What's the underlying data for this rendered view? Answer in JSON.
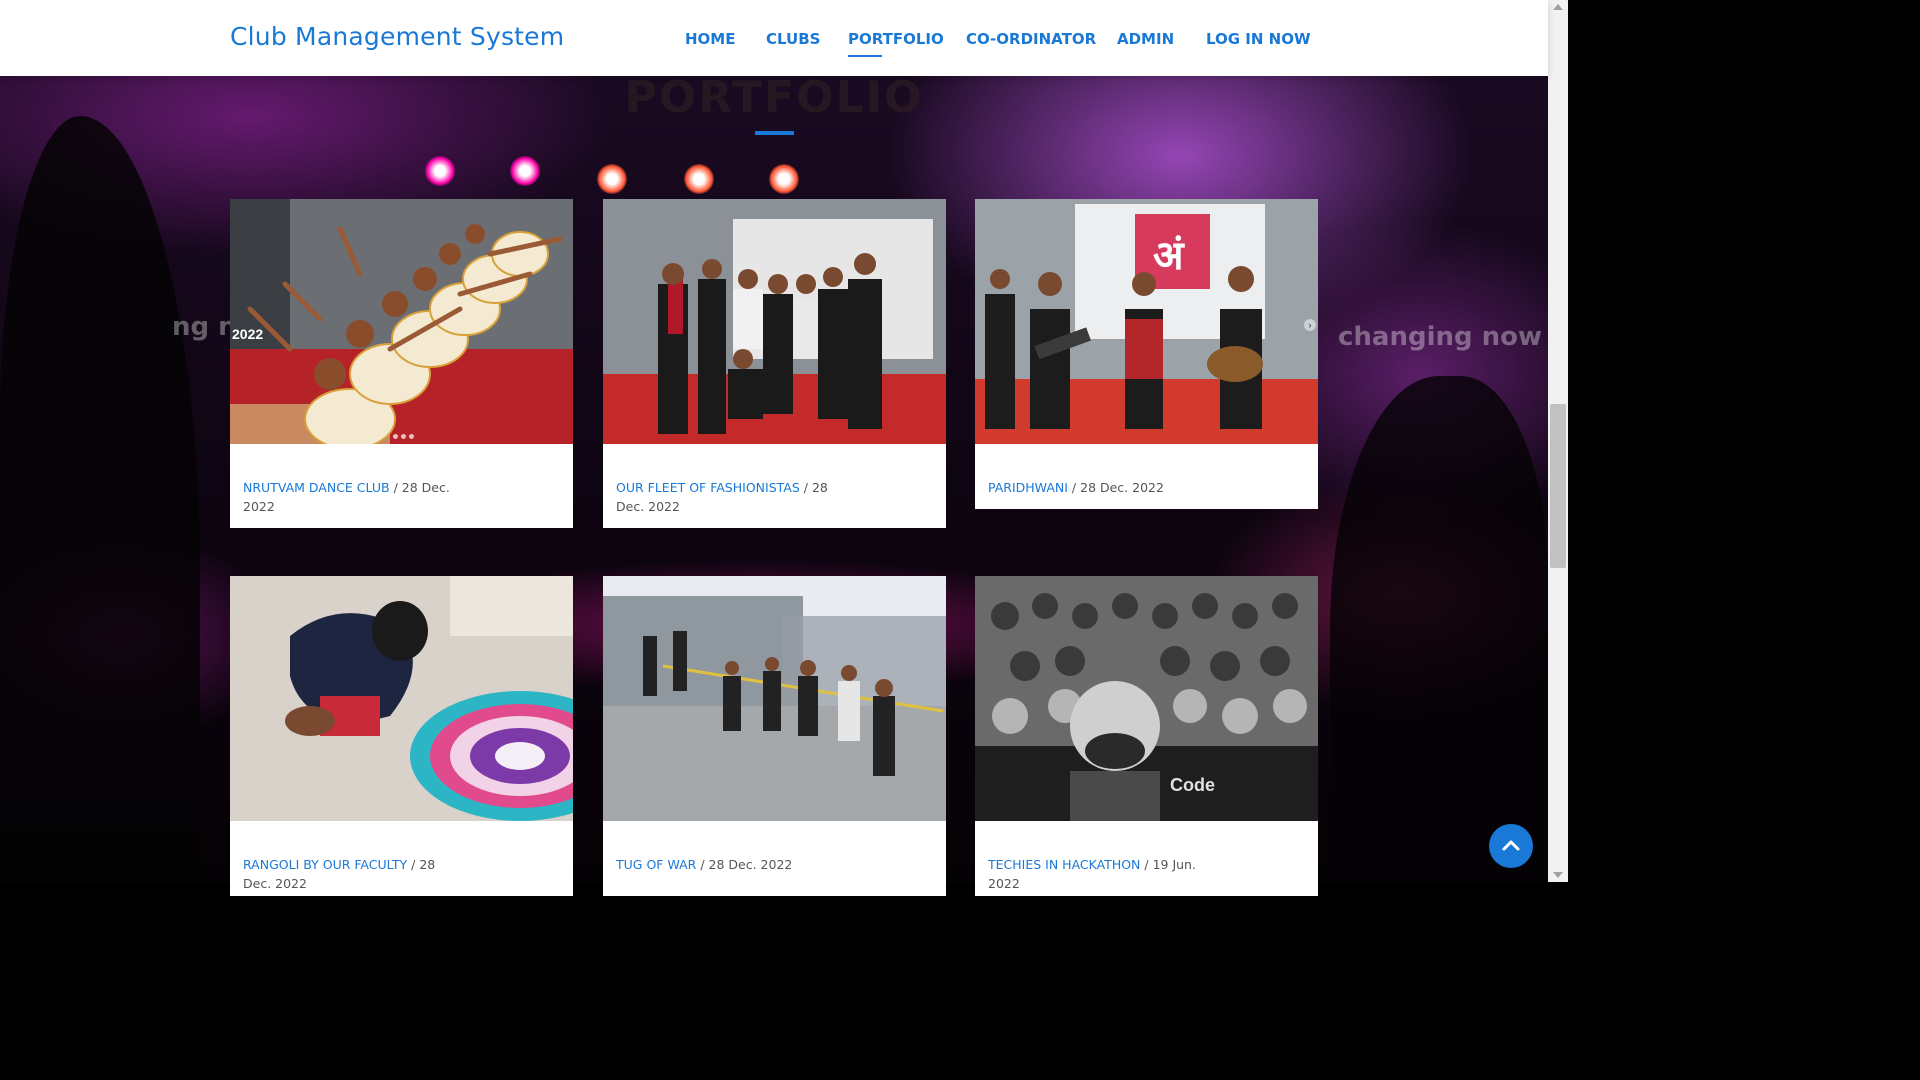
{
  "header": {
    "brand": "Club Management System",
    "nav": [
      {
        "label": "HOME"
      },
      {
        "label": "CLUBS"
      },
      {
        "label": "PORTFOLIO"
      },
      {
        "label": "CO-ORDINATOR"
      },
      {
        "label": "ADMIN"
      },
      {
        "label": "LOG IN NOW"
      }
    ],
    "active": "PORTFOLIO"
  },
  "section": {
    "title": "PORTFOLIO",
    "background_text_left": "ng n",
    "background_text_right": "changing now"
  },
  "portfolio": [
    {
      "title": "NRUTVAM DANCE CLUB",
      "date_line1": " / 28 Dec.",
      "date_line2": "2022"
    },
    {
      "title": "OUR FLEET OF FASHIONISTAS",
      "date_line1": " / 28",
      "date_line2": "Dec. 2022"
    },
    {
      "title": "PARIDHWANI",
      "date_line1": " / 28 Dec. 2022",
      "date_line2": ""
    },
    {
      "title": "RANGOLI BY OUR FACULTY",
      "date_line1": " / 28",
      "date_line2": "Dec. 2022"
    },
    {
      "title": "TUG OF WAR",
      "date_line1": " / 28 Dec. 2022",
      "date_line2": ""
    },
    {
      "title": "TECHIES IN HACKATHON",
      "date_line1": " / 19 Jun.",
      "date_line2": "2022"
    }
  ],
  "colors": {
    "accent": "#1a78d6",
    "header_bg": "#ffffff"
  },
  "icons": {
    "back_to_top": "chevron-up-icon"
  }
}
